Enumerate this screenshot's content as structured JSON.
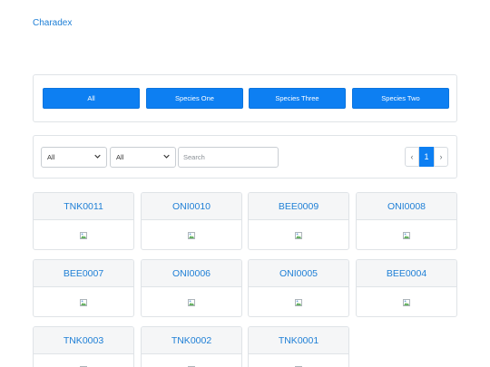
{
  "brand": "Charadex",
  "species_buttons": [
    "All",
    "Species One",
    "Species Three",
    "Species Two"
  ],
  "filters": {
    "select1": "All",
    "select2": "All",
    "search_placeholder": "Search"
  },
  "pagination": {
    "prev": "‹",
    "current": "1",
    "next": "›"
  },
  "cards": [
    "TNK0011",
    "ONI0010",
    "BEE0009",
    "ONI0008",
    "BEE0007",
    "ONI0006",
    "ONI0005",
    "BEE0004",
    "TNK0003",
    "TNK0002",
    "TNK0001"
  ],
  "icons": {
    "broken_image": "broken-image-icon",
    "chevron": "chevron-down-icon"
  },
  "colors": {
    "accent": "#0d7ff2",
    "link": "#1e7fd6"
  }
}
